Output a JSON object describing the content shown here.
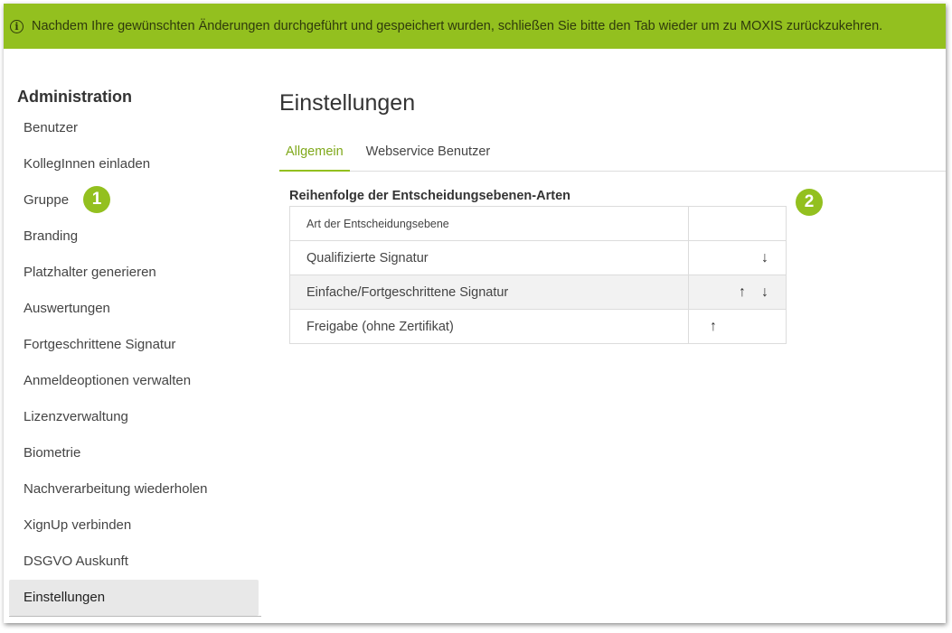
{
  "banner": {
    "message": "Nachdem Ihre gewünschten Änderungen durchgeführt und gespeichert wurden, schließen Sie bitte den Tab wieder um zu MOXIS zurückzukehren.",
    "icon": "info-icon"
  },
  "sidebar": {
    "title": "Administration",
    "items": [
      {
        "label": "Benutzer"
      },
      {
        "label": "KollegInnen einladen"
      },
      {
        "label": "Gruppe"
      },
      {
        "label": "Branding"
      },
      {
        "label": "Platzhalter generieren"
      },
      {
        "label": "Auswertungen"
      },
      {
        "label": "Fortgeschrittene Signatur"
      },
      {
        "label": "Anmeldeoptionen verwalten"
      },
      {
        "label": "Lizenzverwaltung"
      },
      {
        "label": "Biometrie"
      },
      {
        "label": "Nachverarbeitung wiederholen"
      },
      {
        "label": "XignUp verbinden"
      },
      {
        "label": "DSGVO Auskunft"
      },
      {
        "label": "Einstellungen",
        "active": true
      }
    ]
  },
  "callouts": {
    "one": "1",
    "two": "2"
  },
  "main": {
    "title": "Einstellungen",
    "tabs": [
      {
        "label": "Allgemein",
        "active": true
      },
      {
        "label": "Webservice Benutzer"
      }
    ],
    "section_title": "Reihenfolge der Entscheidungsebenen-Arten",
    "table": {
      "header": "Art der Entscheidungsebene",
      "rows": [
        {
          "name": "Qualifizierte Signatur",
          "up": false,
          "down": true
        },
        {
          "name": "Einfache/Fortgeschrittene Signatur",
          "up": true,
          "down": true
        },
        {
          "name": "Freigabe (ohne Zertifikat)",
          "up": true,
          "down": false
        }
      ],
      "up_glyph": "↑",
      "down_glyph": "↓"
    }
  },
  "colors": {
    "accent": "#93c01f",
    "selected_bg": "#e8e8e8"
  }
}
